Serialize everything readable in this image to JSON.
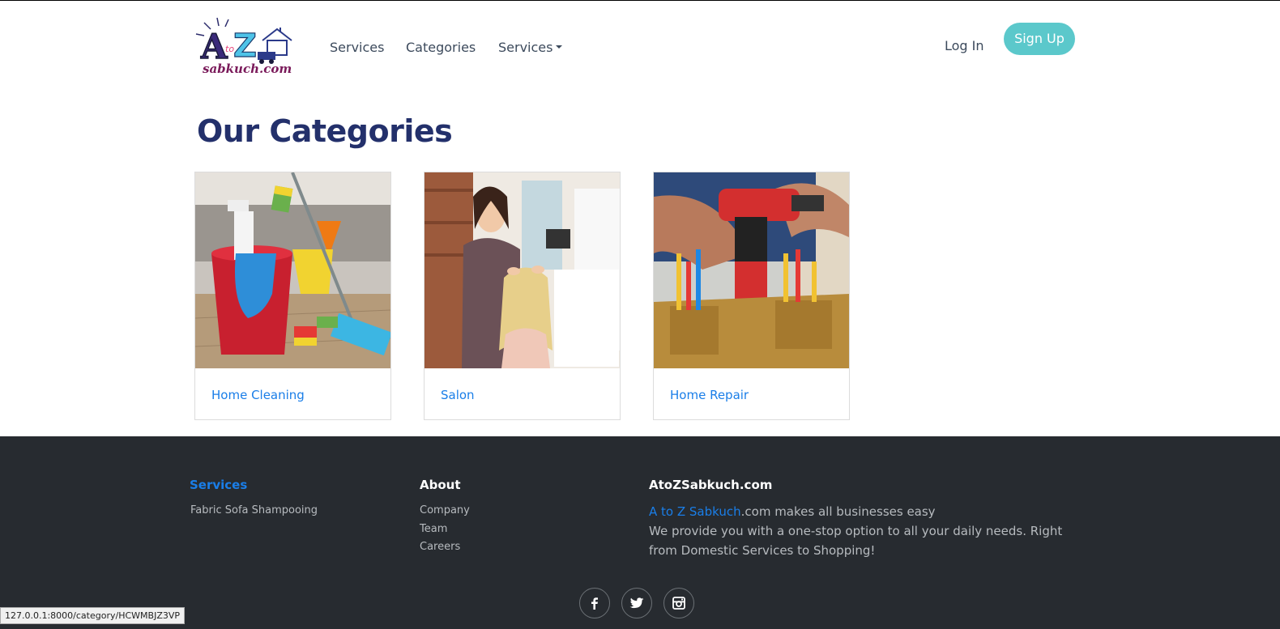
{
  "nav": {
    "logo_alt_text": "sabkuch.com",
    "links": [
      {
        "label": "Services"
      },
      {
        "label": "Categories"
      },
      {
        "label": "Services"
      }
    ],
    "login_label": "Log In",
    "signup_label": "Sign Up"
  },
  "main": {
    "title": "Our Categories",
    "categories": [
      {
        "label": "Home Cleaning",
        "image_icon": "cleaning-bucket-photo"
      },
      {
        "label": "Salon",
        "image_icon": "salon-stylist-photo"
      },
      {
        "label": "Home Repair",
        "image_icon": "tool-belt-drill-photo"
      }
    ]
  },
  "footer": {
    "services_heading": "Services",
    "services_items": [
      "Fabric Sofa Shampooing"
    ],
    "about_heading": "About",
    "about_items": [
      "Company",
      "Team",
      "Careers"
    ],
    "site_heading": "AtoZSabkuch.com",
    "tagline_highlight": "A to Z Sabkuch",
    "tagline_rest": ".com makes all businesses easy",
    "description": "We provide you with a one-stop option to all your daily needs. Right from Domestic Services to Shopping!",
    "social_icons": [
      "facebook-icon",
      "twitter-icon",
      "instagram-icon"
    ]
  },
  "statusbar": {
    "url": "127.0.0.1:8000/category/HCWMBJZ3VP"
  },
  "colors": {
    "brand_navy": "#23306b",
    "link_blue": "#1a7ee8",
    "signup_teal": "#5bc8cb",
    "footer_bg": "#272b30"
  }
}
